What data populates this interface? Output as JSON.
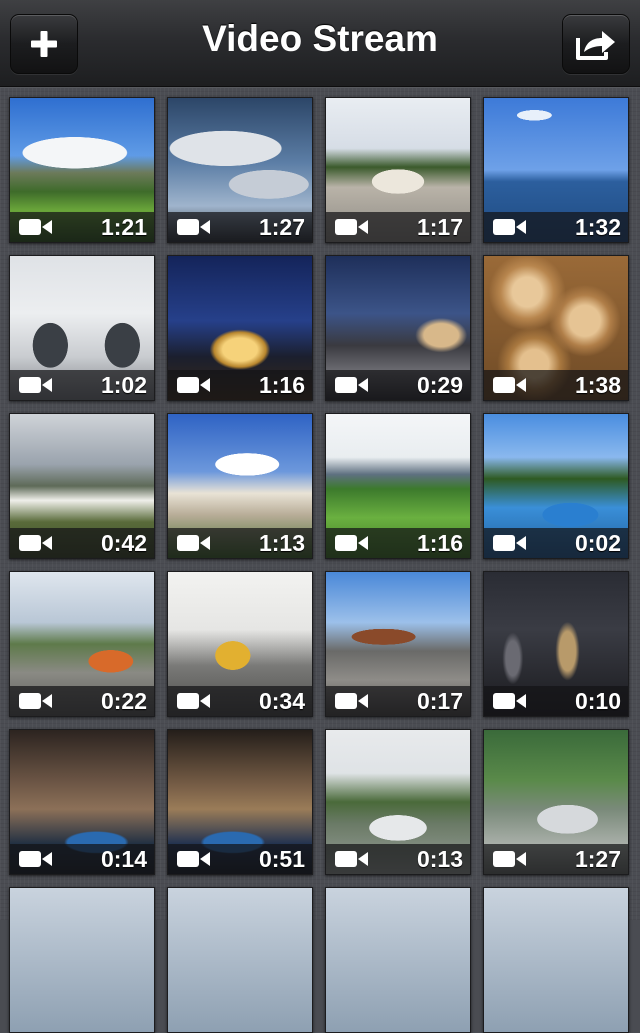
{
  "navbar": {
    "title": "Video Stream",
    "left_icon": "plus-icon",
    "right_icon": "share-icon"
  },
  "videos": [
    {
      "duration": "1:21",
      "thumb": "mountain-landscape"
    },
    {
      "duration": "1:27",
      "thumb": "cloudy-sky"
    },
    {
      "duration": "1:17",
      "thumb": "yurt"
    },
    {
      "duration": "1:32",
      "thumb": "ocean-horizon"
    },
    {
      "duration": "1:02",
      "thumb": "white-arches"
    },
    {
      "duration": "1:16",
      "thumb": "lit-gateway"
    },
    {
      "duration": "0:29",
      "thumb": "resort-walkway-dusk"
    },
    {
      "duration": "1:38",
      "thumb": "wood-logs"
    },
    {
      "duration": "0:42",
      "thumb": "mountain-buildings"
    },
    {
      "duration": "1:13",
      "thumb": "resort-building"
    },
    {
      "duration": "1:16",
      "thumb": "garden-lawn"
    },
    {
      "duration": "0:02",
      "thumb": "pool-palms"
    },
    {
      "duration": "0:22",
      "thumb": "orange-train"
    },
    {
      "duration": "0:34",
      "thumb": "train-station"
    },
    {
      "duration": "0:17",
      "thumb": "railway-tracks"
    },
    {
      "duration": "0:10",
      "thumb": "night-city"
    },
    {
      "duration": "0:14",
      "thumb": "indoor-pool"
    },
    {
      "duration": "0:51",
      "thumb": "indoor-pool-2"
    },
    {
      "duration": "0:13",
      "thumb": "gullwing-car"
    },
    {
      "duration": "1:27",
      "thumb": "silver-car"
    }
  ],
  "colors": {
    "background": "#4b4d53",
    "navbar": "#2b2c2f",
    "overlay": "#141416"
  }
}
